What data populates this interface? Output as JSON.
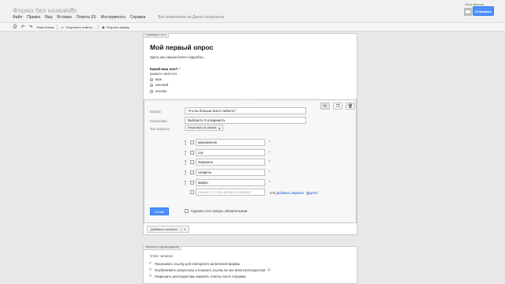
{
  "header": {
    "doc_title": "Форма без названия",
    "user_name": "Петр Иванов",
    "send_label": "Отправить",
    "menu": [
      "Файл",
      "Правка",
      "Вид",
      "Вставка",
      "Ответы (0)",
      "Инструменты",
      "Справка"
    ],
    "saved_status": "Все изменения на Диске сохранены"
  },
  "toolbar": {
    "theme_label": "Темы Бланк",
    "save_responses_label": "Сохранять ответы...",
    "view_form_label": "Открыть форму"
  },
  "form": {
    "page_indicator": "Страница 1 из 1",
    "title": "Мой первый опрос",
    "description": "Здесь мы пишем более подробно...",
    "question1": {
      "title": "Какой ваш пол?",
      "required_mark": "*",
      "help": "укажите свой пол",
      "options": [
        "муж",
        "женский",
        "незнаю"
      ]
    }
  },
  "editor": {
    "question_label": "Вопрос",
    "question_value": "Что вы больше всего любите?",
    "help_label": "Пояснение",
    "help_value": "Выберете 3-и варианта",
    "type_label": "Тип вопроса",
    "type_value": "Несколько из списка",
    "options": [
      "мороженное",
      "сок",
      "пирожное",
      "конфеты",
      "вафли"
    ],
    "new_option_placeholder": "Нажмите, чтобы добавить вариант",
    "add_other_prefix": "или",
    "add_other_link": "Добавить вариант \"Другое\"",
    "done_label": "Готово",
    "required_label": "Сделать этот вопрос обязательным"
  },
  "add_item_label": "Добавить элемент",
  "confirmation": {
    "tab_label": "Изменить подтверждение",
    "label": "Ответ записан",
    "options": [
      {
        "label": "Показывать ссылку для повторного заполнения формы",
        "checked": true
      },
      {
        "label": "Опубликовать результаты и показать ссылку на них всем респондентам",
        "checked": false,
        "help": true
      },
      {
        "label": "Разрешить респондентам изменять ответы после отправки",
        "checked": false
      }
    ]
  },
  "colors": {
    "accent": "#4d90fe",
    "link": "#1155cc",
    "required": "#cc0000"
  }
}
